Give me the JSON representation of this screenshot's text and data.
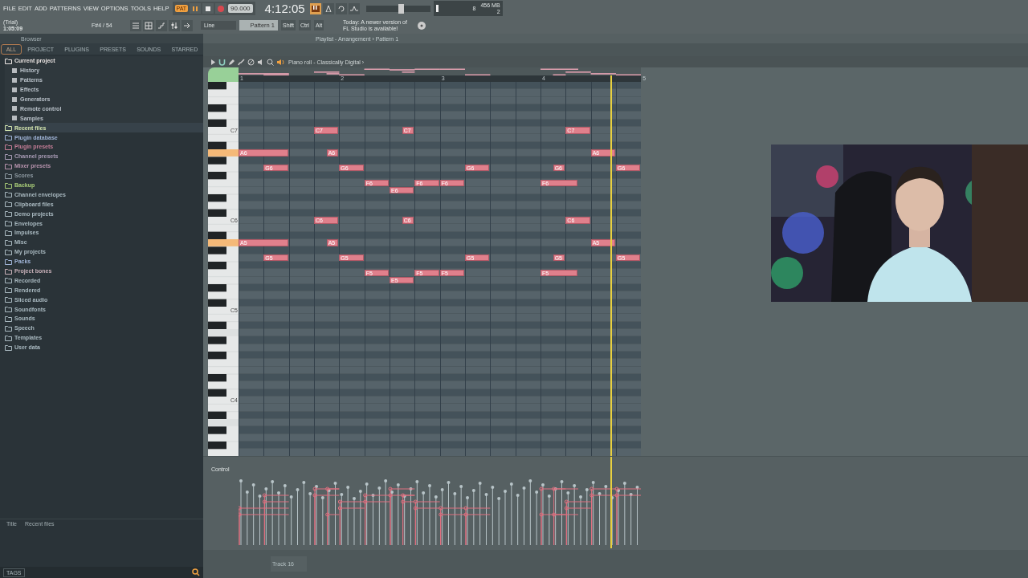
{
  "menu": [
    "FILE",
    "EDIT",
    "ADD",
    "PATTERNS",
    "VIEW",
    "OPTIONS",
    "TOOLS",
    "HELP"
  ],
  "transport": {
    "mode": "PAT",
    "tempo": "90.000",
    "time": "4:12:05"
  },
  "status": {
    "trial": "(Trial)",
    "time": "1:05:09",
    "hint": "F#4 / 54"
  },
  "cpu": {
    "cores": "8",
    "memory": "456 MB",
    "polyphony": "2"
  },
  "master_pitch": {
    "level": 0.55
  },
  "toolbar": {
    "snap": "Line",
    "pattern": "Pattern 1",
    "keys": [
      "Shift",
      "Ctrl",
      "Alt"
    ],
    "news": [
      "Today: A newer version of",
      "FL Studio is available!"
    ]
  },
  "browser": {
    "title": "Browser",
    "tabs": [
      {
        "label": "ALL",
        "selected": true
      },
      {
        "label": "PROJECT",
        "selected": false
      },
      {
        "label": "PLUGINS",
        "selected": false
      },
      {
        "label": "PRESETS",
        "selected": false
      },
      {
        "label": "SOUNDS",
        "selected": false
      },
      {
        "label": "STARRED",
        "selected": false
      }
    ],
    "items": [
      {
        "label": "Current project",
        "color": "#ece6e4",
        "selected": false,
        "expanded": true,
        "children": [
          {
            "label": "History"
          },
          {
            "label": "Patterns"
          },
          {
            "label": "Effects"
          },
          {
            "label": "Generators"
          },
          {
            "label": "Remote control"
          },
          {
            "label": "Samples"
          }
        ]
      },
      {
        "label": "Recent files",
        "color": "#d6e8b0",
        "selected": true
      },
      {
        "label": "Plugin database",
        "color": "#9fb3d6",
        "selected": false
      },
      {
        "label": "Plugin presets",
        "color": "#c47d96",
        "selected": false
      },
      {
        "label": "Channel presets",
        "color": "#a99cb6",
        "selected": false
      },
      {
        "label": "Mixer presets",
        "color": "#b894ae",
        "selected": false
      },
      {
        "label": "Scores",
        "color": "#8e9aa2",
        "selected": false
      },
      {
        "label": "Backup",
        "color": "#a8cc78",
        "selected": false
      },
      {
        "label": "Channel envelopes",
        "color": "#a9b9c0",
        "selected": false
      },
      {
        "label": "Clipboard files",
        "color": "#a9b9c0",
        "selected": false
      },
      {
        "label": "Demo projects",
        "color": "#a9b9c0",
        "selected": false
      },
      {
        "label": "Envelopes",
        "color": "#a9b9c0",
        "selected": false
      },
      {
        "label": "Impulses",
        "color": "#a9b9c0",
        "selected": false
      },
      {
        "label": "Misc",
        "color": "#a9b9c0",
        "selected": false
      },
      {
        "label": "My projects",
        "color": "#a9b9c0",
        "selected": false
      },
      {
        "label": "Packs",
        "color": "#9fb3d6",
        "selected": false
      },
      {
        "label": "Project bones",
        "color": "#c8b0b8",
        "selected": false
      },
      {
        "label": "Recorded",
        "color": "#a9b9c0",
        "selected": false
      },
      {
        "label": "Rendered",
        "color": "#a9b9c0",
        "selected": false
      },
      {
        "label": "Sliced audio",
        "color": "#a9b9c0",
        "selected": false
      },
      {
        "label": "Soundfonts",
        "color": "#a9b9c0",
        "selected": false
      },
      {
        "label": "Sounds",
        "color": "#a9b9c0",
        "selected": false
      },
      {
        "label": "Speech",
        "color": "#a9b9c0",
        "selected": false
      },
      {
        "label": "Templates",
        "color": "#a9b9c0",
        "selected": false
      },
      {
        "label": "User data",
        "color": "#a9b9c0",
        "selected": false
      }
    ],
    "detail": {
      "title_label": "Title",
      "title_value": "Recent files"
    },
    "tags": "TAGS"
  },
  "playlist": {
    "title": "Playlist - Arrangement › Pattern 1"
  },
  "piano_roll": {
    "title": "Piano roll - Classically Digital ›",
    "bars": [
      "1",
      "2",
      "3",
      "4",
      "5"
    ],
    "octaves": [
      {
        "label": "C7",
        "lit": true
      },
      {
        "label": "C6",
        "lit": true
      },
      {
        "label": "C5",
        "lit": false
      },
      {
        "label": "C4",
        "lit": false
      }
    ],
    "notes": [
      {
        "label": "C7"
      },
      {
        "label": "C7"
      },
      {
        "label": "C7"
      },
      {
        "label": "A6"
      },
      {
        "label": "A6"
      },
      {
        "label": "A6"
      },
      {
        "label": "G6"
      },
      {
        "label": "G6"
      },
      {
        "label": "G6"
      },
      {
        "label": "G6"
      },
      {
        "label": "G6"
      },
      {
        "label": "F6"
      },
      {
        "label": "F6"
      },
      {
        "label": "F6"
      },
      {
        "label": "F6"
      },
      {
        "label": "E6"
      },
      {
        "label": "C6"
      },
      {
        "label": "C6"
      },
      {
        "label": "C6"
      },
      {
        "label": "A5"
      },
      {
        "label": "A5"
      },
      {
        "label": "A5"
      },
      {
        "label": "G5"
      },
      {
        "label": "G5"
      },
      {
        "label": "G5"
      },
      {
        "label": "G5"
      },
      {
        "label": "G5"
      },
      {
        "label": "F5"
      },
      {
        "label": "F5"
      },
      {
        "label": "F5"
      },
      {
        "label": "F5"
      },
      {
        "label": "E5"
      }
    ],
    "control": "Control"
  },
  "track": "Track 16"
}
